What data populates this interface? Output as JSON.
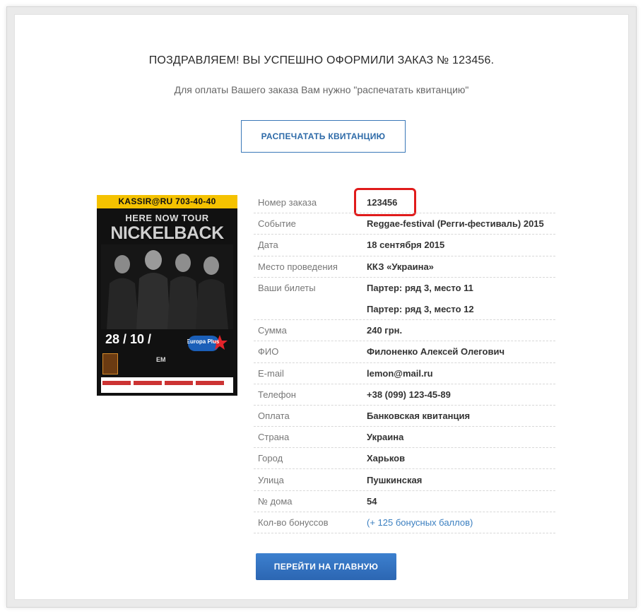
{
  "header": {
    "title": "ПОЗДРАВЛЯЕМ! ВЫ УСПЕШНО ОФОРМИЛИ ЗАКАЗ № 123456.",
    "subtitle": "Для оплаты Вашего заказа Вам нужно  \"распечатать квитанцию\""
  },
  "print_button": {
    "label": "РАСПЕЧАТАТЬ КВИТАНЦИЮ"
  },
  "poster": {
    "topbar": "KASSIR@RU 703-40-40",
    "tour": "HERE NOW TOUR",
    "band": "NICKELBACK",
    "date": "28 / 10 /",
    "sponsor": "Europa Plus",
    "organizer": "EM"
  },
  "details": [
    {
      "label": "Номер заказа",
      "value": "123456"
    },
    {
      "label": "Событие",
      "value": "Reggae-festival (Регги-фестиваль) 2015"
    },
    {
      "label": "Дата",
      "value": "18 сентября 2015"
    },
    {
      "label": "Место проведения",
      "value": "ККЗ «Украина»"
    },
    {
      "label": "Ваши билеты",
      "value": "Партер: ряд 3, место 11"
    },
    {
      "label": "",
      "value": "Партер: ряд 3, место 12"
    },
    {
      "label": "Сумма",
      "value": "240 грн."
    },
    {
      "label": "ФИО",
      "value": "Филоненко Алексей Олегович"
    },
    {
      "label": "E-mail",
      "value": "lemon@mail.ru"
    },
    {
      "label": "Телефон",
      "value": "+38 (099) 123-45-89"
    },
    {
      "label": "Оплата",
      "value": "Банковская квитанция"
    },
    {
      "label": "Страна",
      "value": "Украина"
    },
    {
      "label": "Город",
      "value": "Харьков"
    },
    {
      "label": "Улица",
      "value": "Пушкинская"
    },
    {
      "label": "№ дома",
      "value": "54"
    },
    {
      "label": "Кол-во бонуссов",
      "value": "(+ 125 бонусных баллов)"
    }
  ],
  "home_button": {
    "label": "ПЕРЕЙТИ НА ГЛАВНУЮ"
  },
  "colors": {
    "accent": "#2d6aa8",
    "button_fill": "#2c66b2",
    "highlight": "#e01b1b",
    "link": "#3b7fc0"
  }
}
